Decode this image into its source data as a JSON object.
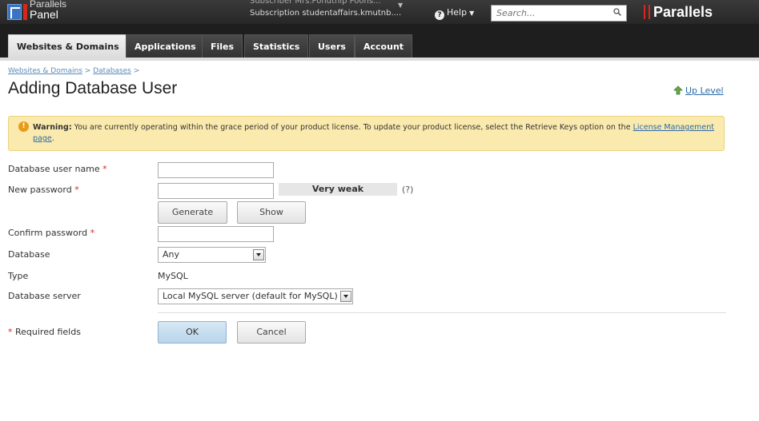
{
  "header": {
    "logo_line1": "Parallels",
    "logo_line2": "Panel",
    "subscriber_line": "Subscriber  Mrs.Pondthip Poons...",
    "subscription_line": "Subscription  studentaffairs.kmutnb....",
    "help_label": "Help",
    "search_placeholder": "Search...",
    "brand_name": "Parallels"
  },
  "tabs": [
    {
      "label": "Websites & Domains",
      "active": true
    },
    {
      "label": "Applications"
    },
    {
      "label": "Files"
    },
    {
      "label": "Statistics"
    },
    {
      "label": "Users"
    },
    {
      "label": "Account"
    }
  ],
  "breadcrumb": {
    "item1": "Websites & Domains",
    "sep1": ">",
    "item2": "Databases",
    "sep2": ">"
  },
  "page_title": "Adding Database User",
  "up_level": "Up Level",
  "warning": {
    "bold": "Warning:",
    "text": "You are currently operating within the grace period of your product license. To update your product license, select the Retrieve Keys option on the",
    "link": "License Management page",
    "end": "."
  },
  "form": {
    "db_user_label": "Database user name",
    "new_password_label": "New password",
    "password_strength": "Very weak",
    "strength_hint": "(?)",
    "generate_label": "Generate",
    "show_label": "Show",
    "confirm_password_label": "Confirm password",
    "database_label": "Database",
    "database_value": "Any",
    "type_label": "Type",
    "type_value": "MySQL",
    "db_server_label": "Database server",
    "db_server_value": "Local MySQL server (default for MySQL)",
    "required_mark": "*",
    "required_note": "Required fields",
    "ok_label": "OK",
    "cancel_label": "Cancel"
  },
  "colors": {
    "accent_red": "#d9261c",
    "link_blue": "#2a6aa8",
    "warning_bg": "#fbeaad"
  }
}
